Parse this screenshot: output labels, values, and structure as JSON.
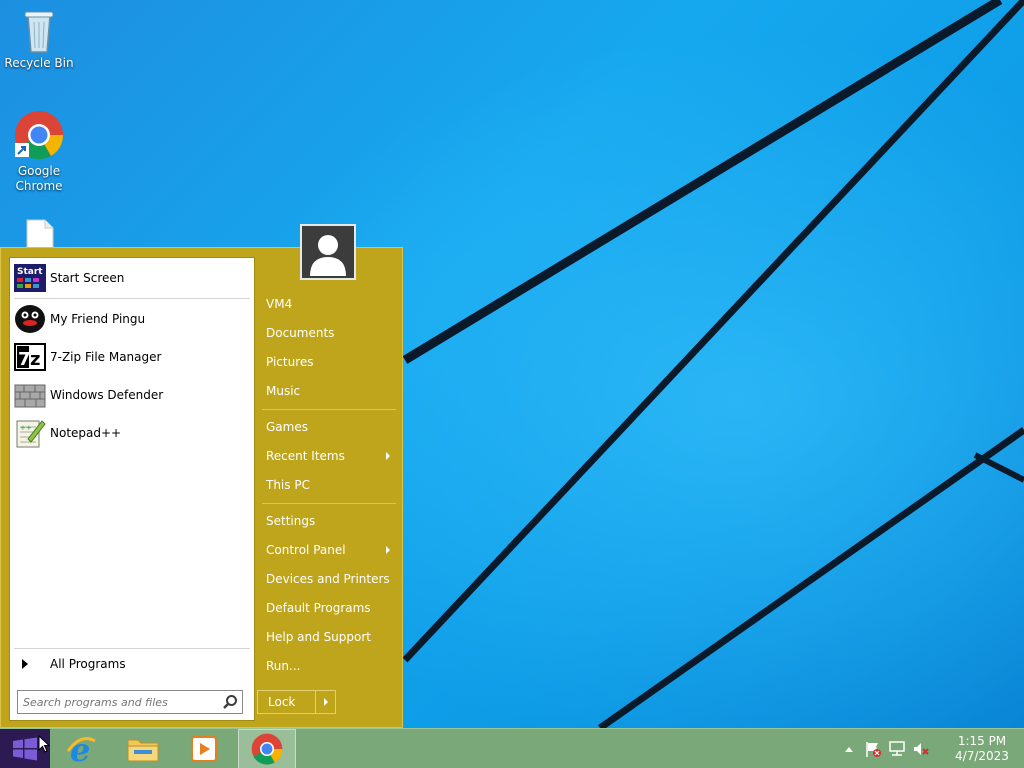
{
  "desktop": {
    "icons": [
      {
        "label": "Recycle Bin",
        "icon": "recycle-bin-icon"
      },
      {
        "label": "Google Chrome",
        "icon": "chrome-icon"
      },
      {
        "label": "",
        "icon": "file-icon"
      }
    ]
  },
  "start_menu": {
    "programs": [
      {
        "label": "Start Screen",
        "icon": "start-screen-icon"
      },
      {
        "label": "My Friend Pingu",
        "icon": "pingu-icon"
      },
      {
        "label": "7-Zip File Manager",
        "icon": "7zip-icon"
      },
      {
        "label": "Windows Defender",
        "icon": "windows-defender-icon"
      },
      {
        "label": "Notepad++",
        "icon": "notepad-plus-plus-icon"
      }
    ],
    "all_programs_label": "All Programs",
    "search_placeholder": "Search programs and files",
    "right_items": [
      {
        "label": "VM4"
      },
      {
        "label": "Documents"
      },
      {
        "label": "Pictures"
      },
      {
        "label": "Music"
      },
      {
        "label": "Games"
      },
      {
        "label": "Recent Items"
      },
      {
        "label": "This PC"
      },
      {
        "label": "Settings"
      },
      {
        "label": "Control Panel"
      },
      {
        "label": "Devices and Printers"
      },
      {
        "label": "Default Programs"
      },
      {
        "label": "Help and Support"
      },
      {
        "label": "Run..."
      }
    ],
    "lock_label": "Lock",
    "accent_color": "#bfa51c"
  },
  "taskbar": {
    "apps": [
      "start-button",
      "internet-explorer-icon",
      "file-explorer-icon",
      "media-player-icon",
      "chrome-icon"
    ],
    "clock_time": "1:15 PM",
    "clock_date": "4/7/2023"
  }
}
